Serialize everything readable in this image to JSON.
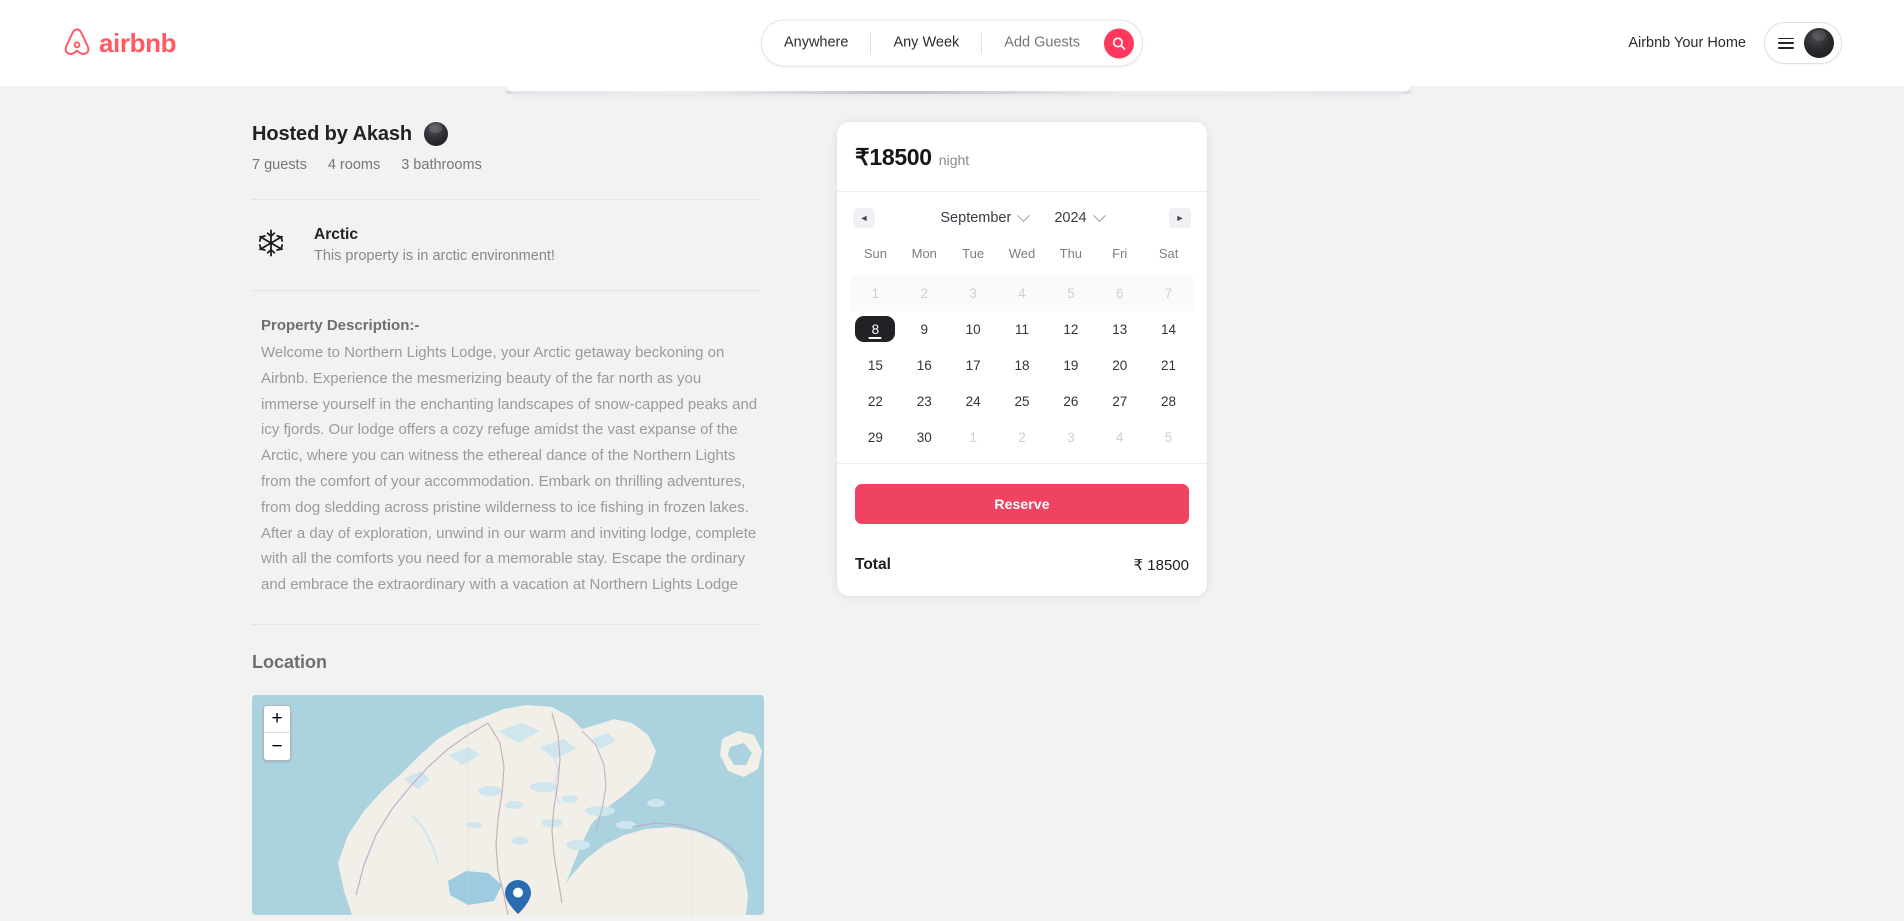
{
  "header": {
    "brand": "airbnb",
    "brand_color": "#FF5A5F",
    "search": {
      "location": "Anywhere",
      "dates": "Any Week",
      "guests": "Add Guests",
      "button_icon": "search-icon",
      "button_color": "#FF385C"
    },
    "host_your_home": "Airbnb Your Home",
    "menu_icon": "hamburger-icon",
    "avatar": "user-avatar"
  },
  "listing": {
    "host_title": "Hosted by Akash",
    "host_avatar": "host-avatar",
    "meta": [
      "7 guests",
      "4 rooms",
      "3 bathrooms"
    ],
    "feature": {
      "icon": "snowflake-icon",
      "title": "Arctic",
      "subtitle": "This property is in arctic environment!"
    },
    "description_heading": "Property Description:-",
    "description": "Welcome to Northern Lights Lodge, your Arctic getaway beckoning on Airbnb. Experience the mesmerizing beauty of the far north as you immerse yourself in the enchanting landscapes of snow-capped peaks and icy fjords. Our lodge offers a cozy refuge amidst the vast expanse of the Arctic, where you can witness the ethereal dance of the Northern Lights from the comfort of your accommodation. Embark on thrilling adventures, from dog sledding across pristine wilderness to ice fishing in frozen lakes. After a day of exploration, unwind in our warm and inviting lodge, complete with all the comforts you need for a memorable stay. Escape the ordinary and embrace the extraordinary with a vacation at Northern Lights Lodge",
    "location_heading": "Location"
  },
  "map": {
    "zoom_in": "+",
    "zoom_out": "−",
    "marker": "location-pin",
    "region": "Nordic / Scandinavia"
  },
  "booking": {
    "price_amount": "₹18500",
    "price_unit": "night",
    "calendar": {
      "prev_icon": "◄",
      "next_icon": "►",
      "month": "September",
      "year": "2024",
      "day_headers": [
        "Sun",
        "Mon",
        "Tue",
        "Wed",
        "Thu",
        "Fri",
        "Sat"
      ],
      "weeks": [
        [
          {
            "d": "1",
            "state": "out"
          },
          {
            "d": "2",
            "state": "out"
          },
          {
            "d": "3",
            "state": "out"
          },
          {
            "d": "4",
            "state": "out"
          },
          {
            "d": "5",
            "state": "out"
          },
          {
            "d": "6",
            "state": "out"
          },
          {
            "d": "7",
            "state": "out"
          }
        ],
        [
          {
            "d": "8",
            "state": "sel"
          },
          {
            "d": "9",
            "state": "in"
          },
          {
            "d": "10",
            "state": "in"
          },
          {
            "d": "11",
            "state": "in"
          },
          {
            "d": "12",
            "state": "in"
          },
          {
            "d": "13",
            "state": "in"
          },
          {
            "d": "14",
            "state": "in"
          }
        ],
        [
          {
            "d": "15",
            "state": "in"
          },
          {
            "d": "16",
            "state": "in"
          },
          {
            "d": "17",
            "state": "in"
          },
          {
            "d": "18",
            "state": "in"
          },
          {
            "d": "19",
            "state": "in"
          },
          {
            "d": "20",
            "state": "in"
          },
          {
            "d": "21",
            "state": "in"
          }
        ],
        [
          {
            "d": "22",
            "state": "in"
          },
          {
            "d": "23",
            "state": "in"
          },
          {
            "d": "24",
            "state": "in"
          },
          {
            "d": "25",
            "state": "in"
          },
          {
            "d": "26",
            "state": "in"
          },
          {
            "d": "27",
            "state": "in"
          },
          {
            "d": "28",
            "state": "in"
          }
        ],
        [
          {
            "d": "29",
            "state": "in"
          },
          {
            "d": "30",
            "state": "in"
          },
          {
            "d": "1",
            "state": "out"
          },
          {
            "d": "2",
            "state": "out"
          },
          {
            "d": "3",
            "state": "out"
          },
          {
            "d": "4",
            "state": "out"
          },
          {
            "d": "5",
            "state": "out"
          }
        ]
      ],
      "selected_day": "8"
    },
    "reserve_label": "Reserve",
    "reserve_color": "#F04261",
    "total_label": "Total",
    "total_value": "₹ 18500"
  }
}
